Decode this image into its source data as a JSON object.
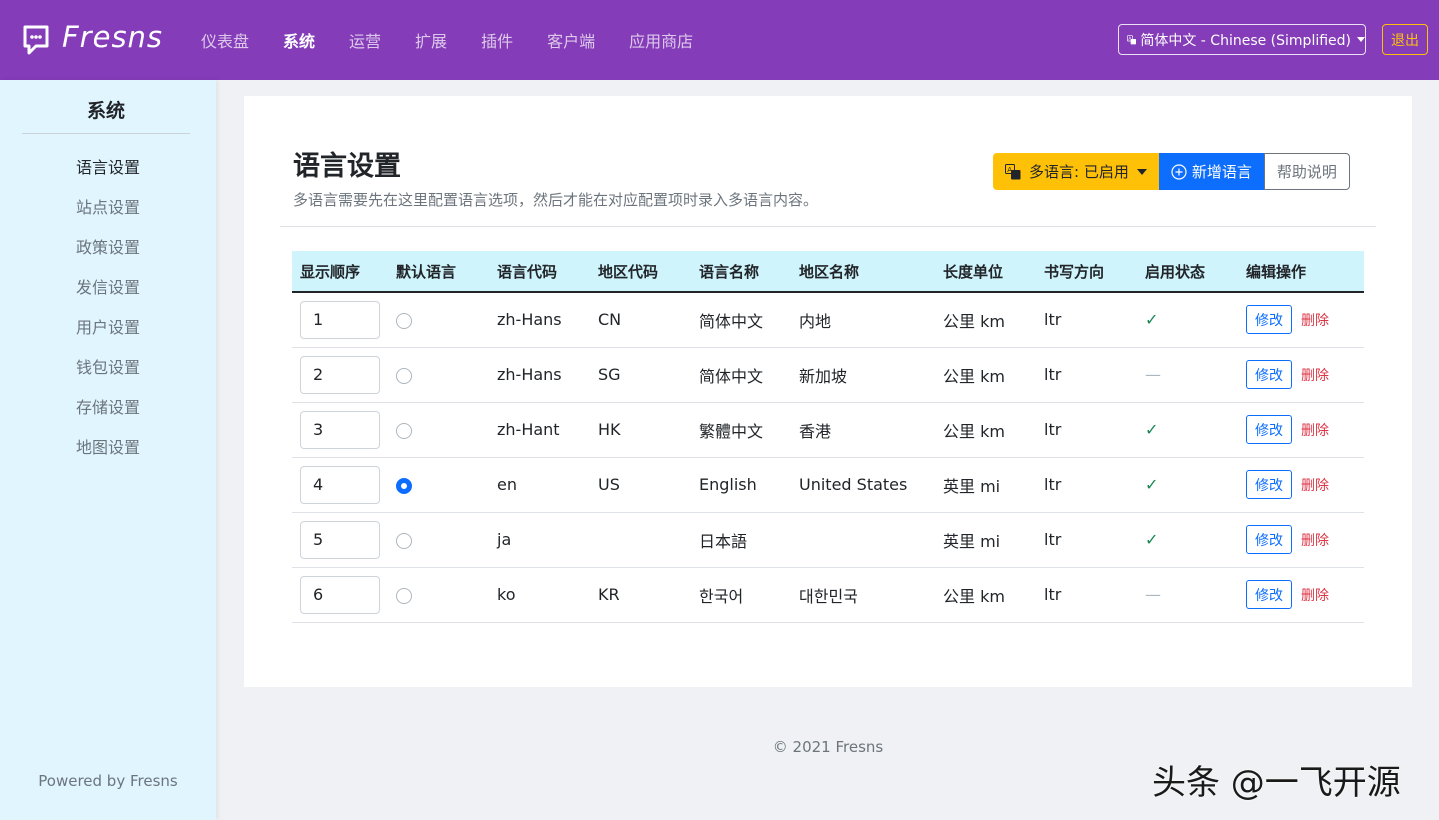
{
  "header": {
    "brand": "Fresns",
    "nav": [
      "仪表盘",
      "系统",
      "运营",
      "扩展",
      "插件",
      "客户端",
      "应用商店"
    ],
    "active_nav": "系统",
    "language_select": "简体中文 - Chinese (Simplified)",
    "logout": "退出"
  },
  "sidebar": {
    "title": "系统",
    "items": [
      {
        "label": "语言设置",
        "active": true
      },
      {
        "label": "站点设置"
      },
      {
        "label": "政策设置"
      },
      {
        "label": "发信设置"
      },
      {
        "label": "用户设置"
      },
      {
        "label": "钱包设置"
      },
      {
        "label": "存储设置"
      },
      {
        "label": "地图设置"
      }
    ],
    "powered": "Powered by Fresns"
  },
  "main": {
    "title": "语言设置",
    "description": "多语言需要先在这里配置语言选项，然后才能在对应配置项时录入多语言内容。",
    "multi_language_button": "多语言: 已启用",
    "add_language_button": "新增语言",
    "help_button": "帮助说明",
    "table": {
      "headers": [
        "显示顺序",
        "默认语言",
        "语言代码",
        "地区代码",
        "语言名称",
        "地区名称",
        "长度单位",
        "书写方向",
        "启用状态",
        "编辑操作"
      ],
      "edit_label": "修改",
      "delete_label": "删除",
      "rows": [
        {
          "order": "1",
          "default": false,
          "lang_code": "zh-Hans",
          "area_code": "CN",
          "lang_name": "简体中文",
          "area_name": "内地",
          "unit": "公里 km",
          "direction": "ltr",
          "enabled": "✓"
        },
        {
          "order": "2",
          "default": false,
          "lang_code": "zh-Hans",
          "area_code": "SG",
          "lang_name": "简体中文",
          "area_name": "新加坡",
          "unit": "公里 km",
          "direction": "ltr",
          "enabled": "—"
        },
        {
          "order": "3",
          "default": false,
          "lang_code": "zh-Hant",
          "area_code": "HK",
          "lang_name": "繁體中文",
          "area_name": "香港",
          "unit": "公里 km",
          "direction": "ltr",
          "enabled": "✓"
        },
        {
          "order": "4",
          "default": true,
          "lang_code": "en",
          "area_code": "US",
          "lang_name": "English",
          "area_name": "United States",
          "unit": "英里 mi",
          "direction": "ltr",
          "enabled": "✓"
        },
        {
          "order": "5",
          "default": false,
          "lang_code": "ja",
          "area_code": "",
          "lang_name": "日本語",
          "area_name": "",
          "unit": "英里 mi",
          "direction": "ltr",
          "enabled": "✓"
        },
        {
          "order": "6",
          "default": false,
          "lang_code": "ko",
          "area_code": "KR",
          "lang_name": "한국어",
          "area_name": "대한민국",
          "unit": "公里 km",
          "direction": "ltr",
          "enabled": "—"
        }
      ]
    }
  },
  "footer": "© 2021 Fresns",
  "watermark": "头条 @一飞开源",
  "colors": {
    "header_bg": "#843cb8",
    "sidebar_bg": "#e1f5fe",
    "accent": "#0d6efd",
    "warning": "#ffc107"
  }
}
